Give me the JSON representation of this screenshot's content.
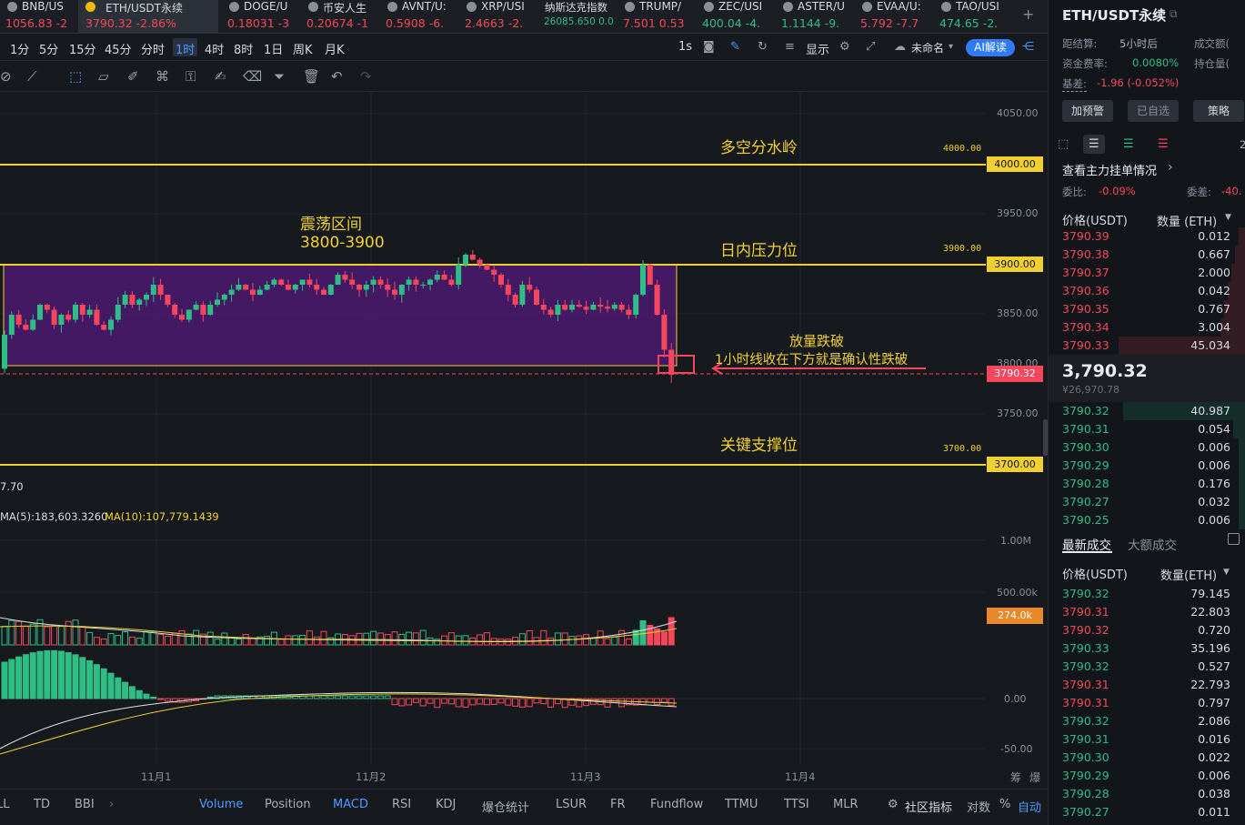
{
  "ticker": [
    {
      "name": "BNB/US",
      "price": "1056.83 -2",
      "color": "#f6465d"
    },
    {
      "name": "ETH/USDT永续",
      "price": "3790.32 -2.86%",
      "color": "#f6465d",
      "active": true
    },
    {
      "name": "DOGE/U",
      "price": "0.18031 -3",
      "color": "#f6465d"
    },
    {
      "name": "币安人生",
      "price": "0.20674 -1",
      "color": "#f6465d"
    },
    {
      "name": "AVNT/U:",
      "price": "0.5908 -6.",
      "color": "#f6465d"
    },
    {
      "name": "XRP/USI",
      "price": "2.4663 -2.",
      "color": "#f6465d"
    },
    {
      "name": "纳斯达克指数",
      "price": "26085.650 0.0",
      "color": "#2ebd85"
    },
    {
      "name": "TRUMP/",
      "price": "7.501 0.53",
      "color": "#f6465d"
    },
    {
      "name": "ZEC/USI",
      "price": "400.04 -4.",
      "color": "#2ebd85"
    },
    {
      "name": "ASTER/U",
      "price": "1.1144 -9.",
      "color": "#2ebd85"
    },
    {
      "name": "EVAA/U:",
      "price": "5.792 -7.7",
      "color": "#f6465d"
    },
    {
      "name": "TAO/USI",
      "price": "474.65 -2.",
      "color": "#2ebd85"
    }
  ],
  "timeframes": [
    "1分",
    "5分",
    "15分",
    "45分",
    "分时",
    "1时",
    "4时",
    "8时",
    "1日",
    "周K",
    "月K"
  ],
  "toolbar_right": {
    "interval": "1s",
    "display": "显示",
    "unnamed": "未命名",
    "ai": "AI解读"
  },
  "chart": {
    "price_labels": [
      "4050.00",
      "4000.00",
      "3950.00",
      "3900.00",
      "3850.00",
      "3800.00",
      "3750.00",
      "3700.00"
    ],
    "tag_4000": "4000.00",
    "tag_3900": "3900.00",
    "tag_3700": "3700.00",
    "tag_current": "3790.32",
    "level_4000_small": "4000.00",
    "level_3900_small": "3900.00",
    "level_3700_small": "3700.00",
    "ann_watershed": "多空分水岭",
    "ann_range_title": "震荡区间",
    "ann_range_value": "3800-3900",
    "ann_resistance": "日内压力位",
    "ann_breakdown": "放量跌破",
    "ann_confirm": "1小时线收在下方就是确认性跌破",
    "ann_support": "关键支撑位",
    "left_value": "7.70",
    "ma5": "MA(5):183,603.3260",
    "ma10": "MA(10):107,779.1439",
    "vol_labels": [
      "1.00M",
      "500.00k"
    ],
    "vol_tag": "274.0k",
    "macd_labels": [
      "0.00",
      "-50.00"
    ],
    "dates": [
      "11月1",
      "11月2",
      "11月3",
      "11月4"
    ],
    "corner_labels": [
      "筹",
      "爆"
    ]
  },
  "indicator_tabs": [
    "LL",
    "TD",
    "BBI",
    "Volume",
    "Position",
    "MACD",
    "RSI",
    "KDJ",
    "爆仓统计",
    "LSUR",
    "FR",
    "Fundflow",
    "TTMU",
    "TTSI",
    "MLR"
  ],
  "indicator_right": {
    "community": "社区指标",
    "log": "对数",
    "pct": "%",
    "auto": "自动"
  },
  "panel": {
    "title": "ETH/USDT永续",
    "settle_label": "距结算:",
    "settle_value": "5小时后",
    "vol_label": "成交额(",
    "funding_label": "资金费率:",
    "funding_value": "0.0080%",
    "hold_label": "持仓量(",
    "basis_label": "基差:",
    "basis_value": "-1.96 (-0.052%)",
    "btn_alert": "加预警",
    "btn_fav": "已自选",
    "btn_strategy": "策略",
    "num_right": "2",
    "depth_link": "查看主力挂单情况",
    "ratio_label": "委比:",
    "ratio_value": "-0.09%",
    "diff_label": "委差:",
    "diff_value": "-40.",
    "ob_price_hdr": "价格(USDT)",
    "ob_qty_hdr": "数量 (ETH)",
    "asks": [
      [
        "3790.39",
        "0.012"
      ],
      [
        "3790.38",
        "0.667"
      ],
      [
        "3790.37",
        "2.000"
      ],
      [
        "3790.36",
        "0.042"
      ],
      [
        "3790.35",
        "0.767"
      ],
      [
        "3790.34",
        "3.004"
      ],
      [
        "3790.33",
        "45.034"
      ]
    ],
    "mid_price": "3,790.32",
    "mid_sub": "¥26,970.78",
    "bids": [
      [
        "3790.32",
        "40.987"
      ],
      [
        "3790.31",
        "0.054"
      ],
      [
        "3790.30",
        "0.006"
      ],
      [
        "3790.29",
        "0.006"
      ],
      [
        "3790.28",
        "0.176"
      ],
      [
        "3790.27",
        "0.032"
      ],
      [
        "3790.25",
        "0.006"
      ]
    ],
    "trades_tab": "最新成交",
    "big_tab": "大额成交",
    "tr_price_hdr": "价格(USDT)",
    "tr_qty_hdr": "数量(ETH)",
    "trades": [
      [
        "3790.32",
        "79.145",
        "g"
      ],
      [
        "3790.31",
        "22.803",
        "r"
      ],
      [
        "3790.32",
        "0.720",
        "r"
      ],
      [
        "3790.33",
        "35.196",
        "g"
      ],
      [
        "3790.32",
        "0.527",
        "g"
      ],
      [
        "3790.31",
        "22.793",
        "r"
      ],
      [
        "3790.31",
        "0.797",
        "r"
      ],
      [
        "3790.32",
        "2.086",
        "g"
      ],
      [
        "3790.31",
        "0.016",
        "g"
      ],
      [
        "3790.30",
        "0.022",
        "g"
      ],
      [
        "3790.29",
        "0.006",
        "g"
      ],
      [
        "3790.28",
        "0.038",
        "g"
      ],
      [
        "3790.27",
        "0.011",
        "g"
      ]
    ]
  },
  "colors": {
    "up": "#2ebd85",
    "down": "#f6465d",
    "level": "#f0d030",
    "range_fill": "#4a1a6e",
    "accent": "#2f7cf6"
  }
}
